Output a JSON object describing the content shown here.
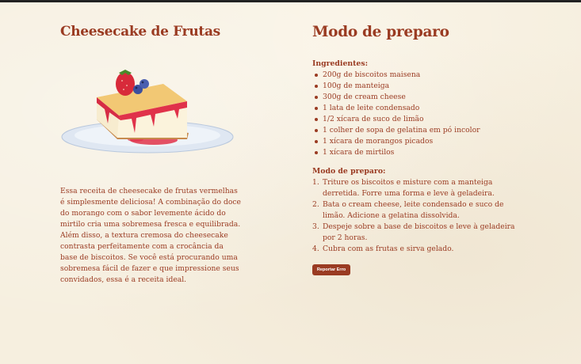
{
  "left": {
    "title": "Cheesecake de Frutas",
    "description": "Essa receita de cheesecake de frutas vermelhas é simplesmente deliciosa! A combinação do doce do morango com o sabor levemente ácido do mirtilo cria uma sobremesa fresca e equilibrada. Além disso, a textura cremosa do cheesecake contrasta perfeitamente com a crocância da base de biscoitos. Se você está procurando uma sobremesa fácil de fazer e que impressione seus convidados, essa é a receita ideal."
  },
  "right": {
    "title": "Modo de preparo",
    "ingredients_title": "Ingredientes:",
    "ingredients": [
      "200g de biscoitos maisena",
      "100g de manteiga",
      "300g de cream cheese",
      "1 lata de leite condensado",
      "1/2 xícara de suco de limão",
      "1 colher de sopa de gelatina em pó incolor",
      "1 xícara de morangos picados",
      "1 xícara de mirtilos"
    ],
    "steps_title": "Modo de preparo:",
    "steps": [
      {
        "num": "1.",
        "text": "Triture os biscoitos e misture com a manteiga derretida. Forre uma forma e leve à geladeira."
      },
      {
        "num": "2.",
        "text": "Bata o cream cheese, leite condensado e suco de limão. Adicione a gelatina dissolvida."
      },
      {
        "num": "3.",
        "text": "Despeje sobre a base de biscoitos e leve à geladeira por 2 horas."
      },
      {
        "num": "4.",
        "text": "Cubra com as frutas e sirva gelado."
      }
    ],
    "report_button": "Reportar Erro"
  },
  "colors": {
    "accent": "#9a3b22",
    "background": "#f6efdf"
  },
  "illustration": {
    "icon": "cheesecake-slice-illustration"
  }
}
